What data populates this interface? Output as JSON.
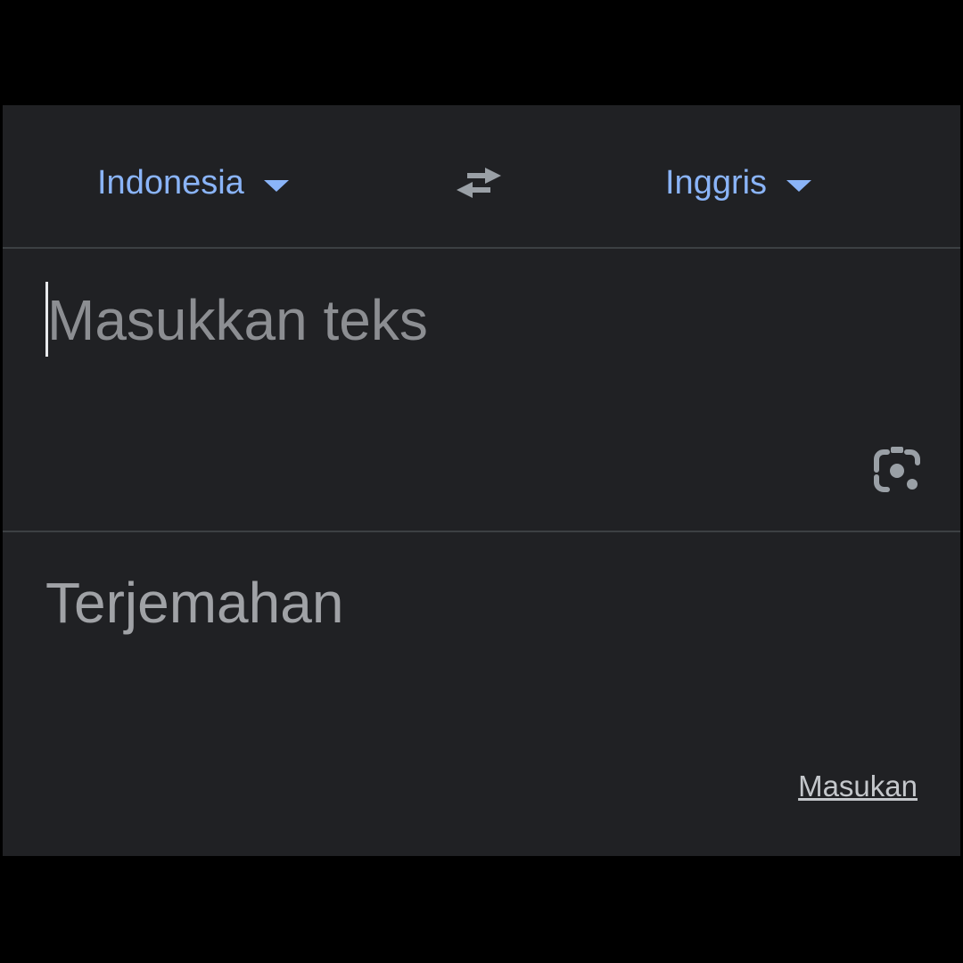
{
  "languages": {
    "source": "Indonesia",
    "target": "Inggris",
    "swap_icon": "swap-arrows-icon",
    "dropdown_icon": "triangle-down-icon"
  },
  "input": {
    "placeholder": "Masukkan teks",
    "value": "",
    "camera_icon": "camera-lens-icon"
  },
  "output": {
    "placeholder": "Terjemahan"
  },
  "footer": {
    "feedback_label": "Masukan"
  },
  "colors": {
    "background": "#202124",
    "accent": "#8ab4f8",
    "divider": "#3c4043"
  }
}
